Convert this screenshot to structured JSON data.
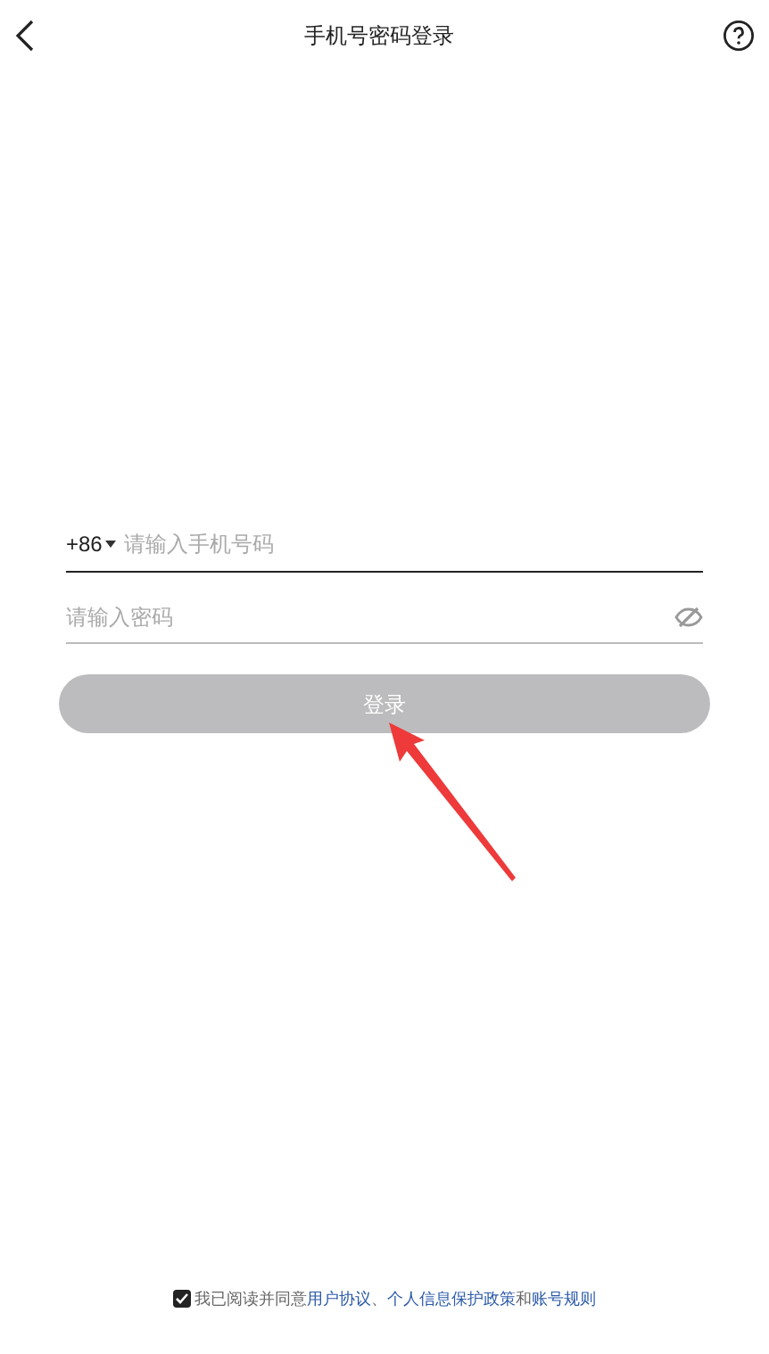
{
  "header": {
    "title": "手机号密码登录"
  },
  "phone_field": {
    "country_code": "+86",
    "placeholder": "请输入手机号码"
  },
  "password_field": {
    "placeholder": "请输入密码",
    "visible": false
  },
  "login_button": {
    "label": "登录",
    "disabled": true
  },
  "agreement": {
    "checked": true,
    "parts": [
      {
        "kind": "text",
        "text": "我已阅读并同意"
      },
      {
        "kind": "link",
        "text": "用户协议"
      },
      {
        "kind": "text",
        "text": "、"
      },
      {
        "kind": "link",
        "text": "个人信息保护政策"
      },
      {
        "kind": "text",
        "text": "和"
      },
      {
        "kind": "link",
        "text": "账号规则"
      }
    ]
  }
}
